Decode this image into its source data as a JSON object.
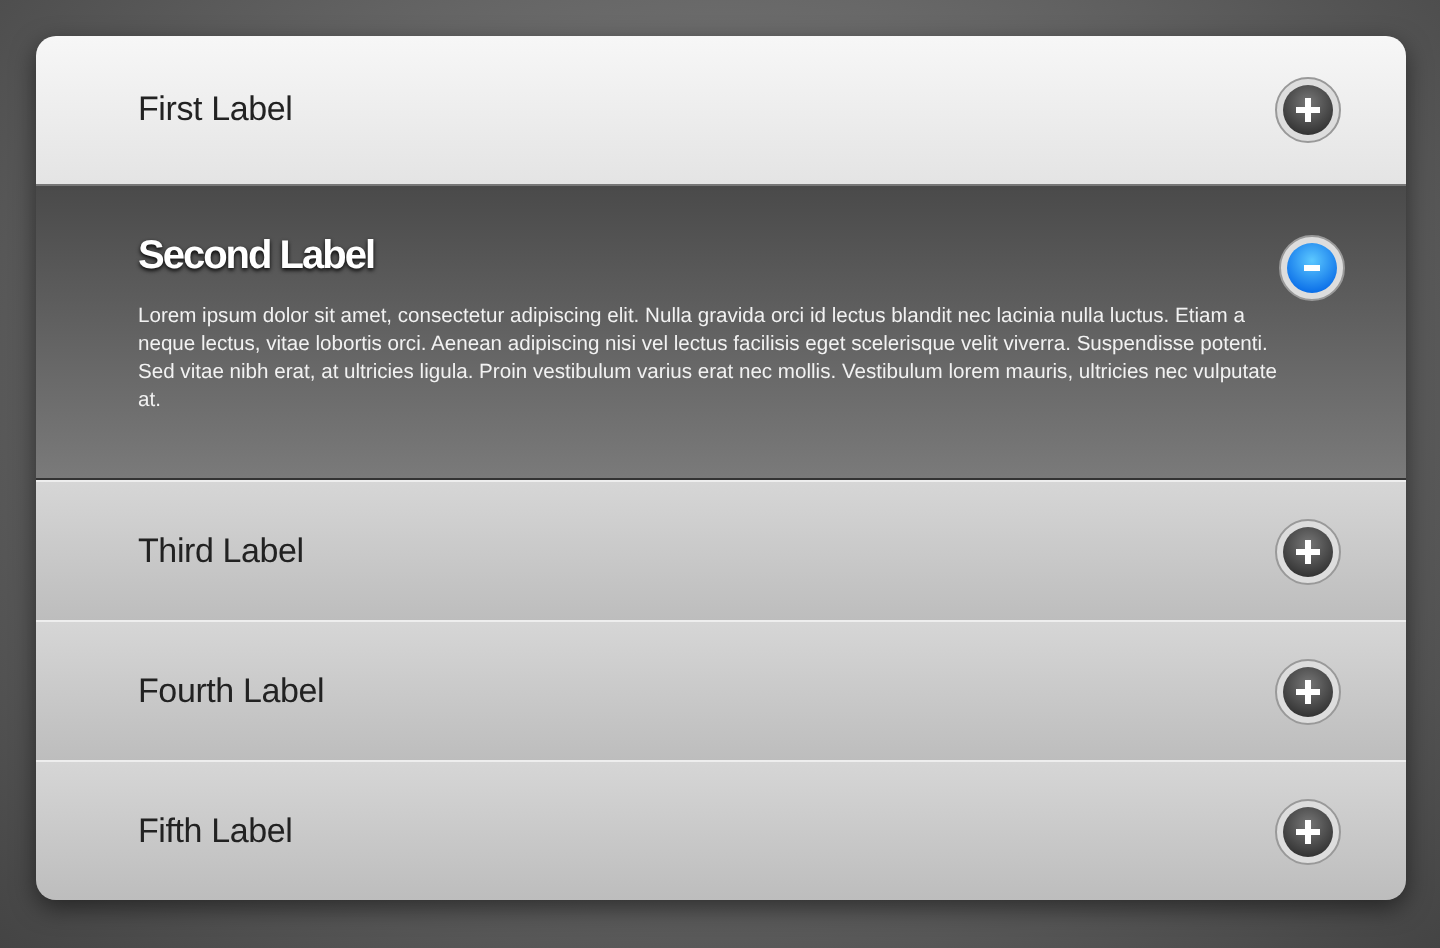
{
  "panels": [
    {
      "label": "First Label",
      "expanded": false
    },
    {
      "label": "Second Label",
      "expanded": true,
      "body": "Lorem ipsum dolor sit amet, consectetur adipiscing elit. Nulla gravida orci id lectus blandit nec lacinia nulla luctus. Etiam a neque lectus, vitae lobortis orci. Aenean adipiscing nisi vel lectus facilisis eget scelerisque velit viverra. Suspendisse potenti. Sed vitae nibh erat, at ultricies ligula. Proin vestibulum varius erat nec mollis.  Vestibulum lorem mauris, ultricies nec vulputate at."
    },
    {
      "label": "Third Label",
      "expanded": false
    },
    {
      "label": "Fourth Label",
      "expanded": false
    },
    {
      "label": "Fifth Label",
      "expanded": false
    }
  ]
}
